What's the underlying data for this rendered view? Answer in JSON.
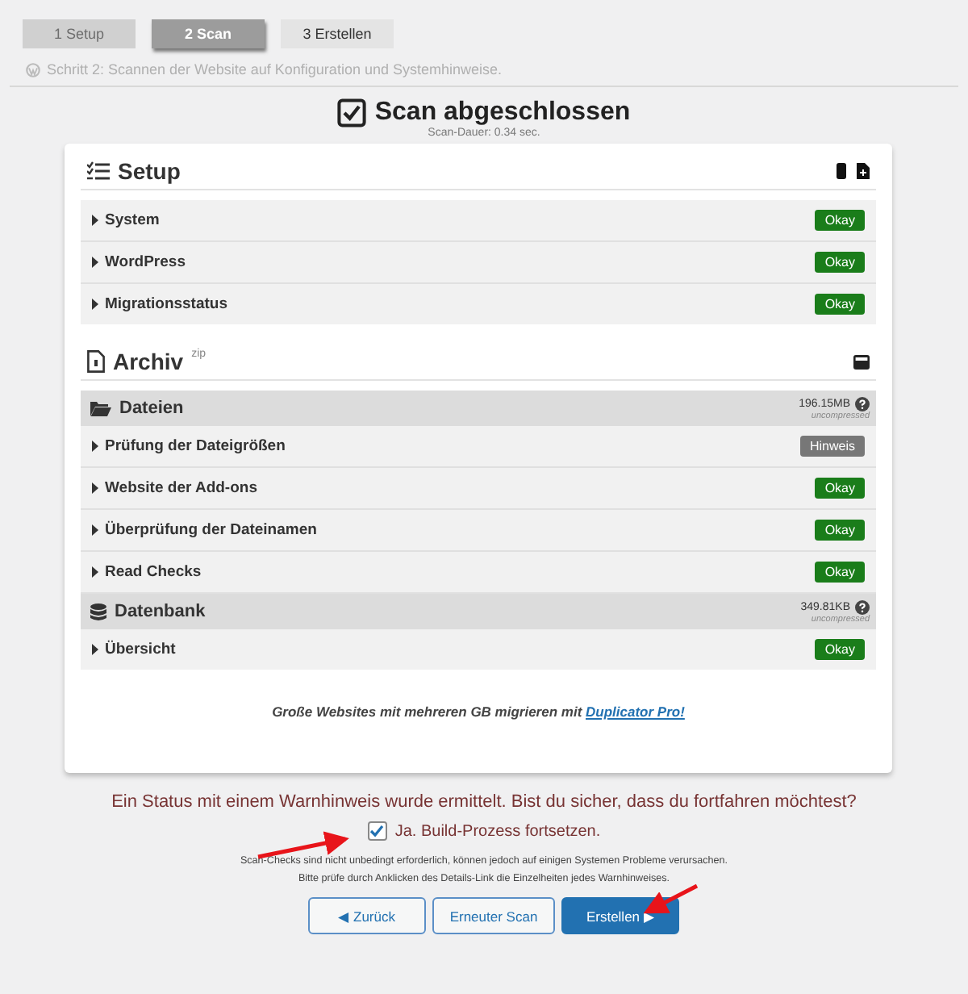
{
  "steps": [
    {
      "label": "1 Setup",
      "selected": false,
      "completed": true
    },
    {
      "label": "2 Scan",
      "selected": true,
      "completed": false
    },
    {
      "label": "3 Erstellen",
      "selected": false,
      "completed": false
    }
  ],
  "step_description": "Schritt 2: Scannen der Website auf Konfiguration und Systemhinweise.",
  "heading": {
    "title": "Scan abgeschlossen",
    "checked": true,
    "duration": "Scan-Dauer: 0.34 sec."
  },
  "setup": {
    "title": "Setup",
    "rows": [
      {
        "label": "System",
        "status": "Okay",
        "kind": "okay"
      },
      {
        "label": "WordPress",
        "status": "Okay",
        "kind": "okay"
      },
      {
        "label": "Migrationsstatus",
        "status": "Okay",
        "kind": "okay"
      }
    ]
  },
  "archive": {
    "title": "Archiv",
    "superscript": "zip",
    "groups": [
      {
        "title": "Dateien",
        "kind": "folder",
        "size": "196.15MB",
        "note": "uncompressed",
        "rows": [
          {
            "label": "Prüfung der Dateigrößen",
            "status": "Hinweis",
            "kind": "hint"
          },
          {
            "label": "Website der Add-ons",
            "status": "Okay",
            "kind": "okay"
          },
          {
            "label": "Überprüfung der Dateinamen",
            "status": "Okay",
            "kind": "okay"
          },
          {
            "label": "Read Checks",
            "status": "Okay",
            "kind": "okay"
          }
        ]
      },
      {
        "title": "Datenbank",
        "kind": "database",
        "size": "349.81KB",
        "note": "uncompressed",
        "rows": [
          {
            "label": "Übersicht",
            "status": "Okay",
            "kind": "okay"
          }
        ]
      }
    ]
  },
  "promo": {
    "text": "Große Websites mit mehreren GB migrieren mit",
    "link": "Duplicator Pro!"
  },
  "warning": "Ein Status mit einem Warnhinweis wurde ermittelt. Bist du sicher, dass du fortfahren möchtest?",
  "confirm": {
    "label": "Ja. Build-Prozess fortsetzen.",
    "checked": true
  },
  "notes": [
    "Scan-Checks sind nicht unbedingt erforderlich, können jedoch auf einigen Systemen Probleme verursachen.",
    "Bitte prüfe durch Anklicken des Details-Link die Einzelheiten jedes Warnhinweises."
  ],
  "buttons": [
    {
      "label": "◀ Zurück",
      "kind": "secondary"
    },
    {
      "label": "Erneuter Scan",
      "kind": "secondary"
    },
    {
      "label": "Erstellen ▶",
      "kind": "primary"
    }
  ]
}
